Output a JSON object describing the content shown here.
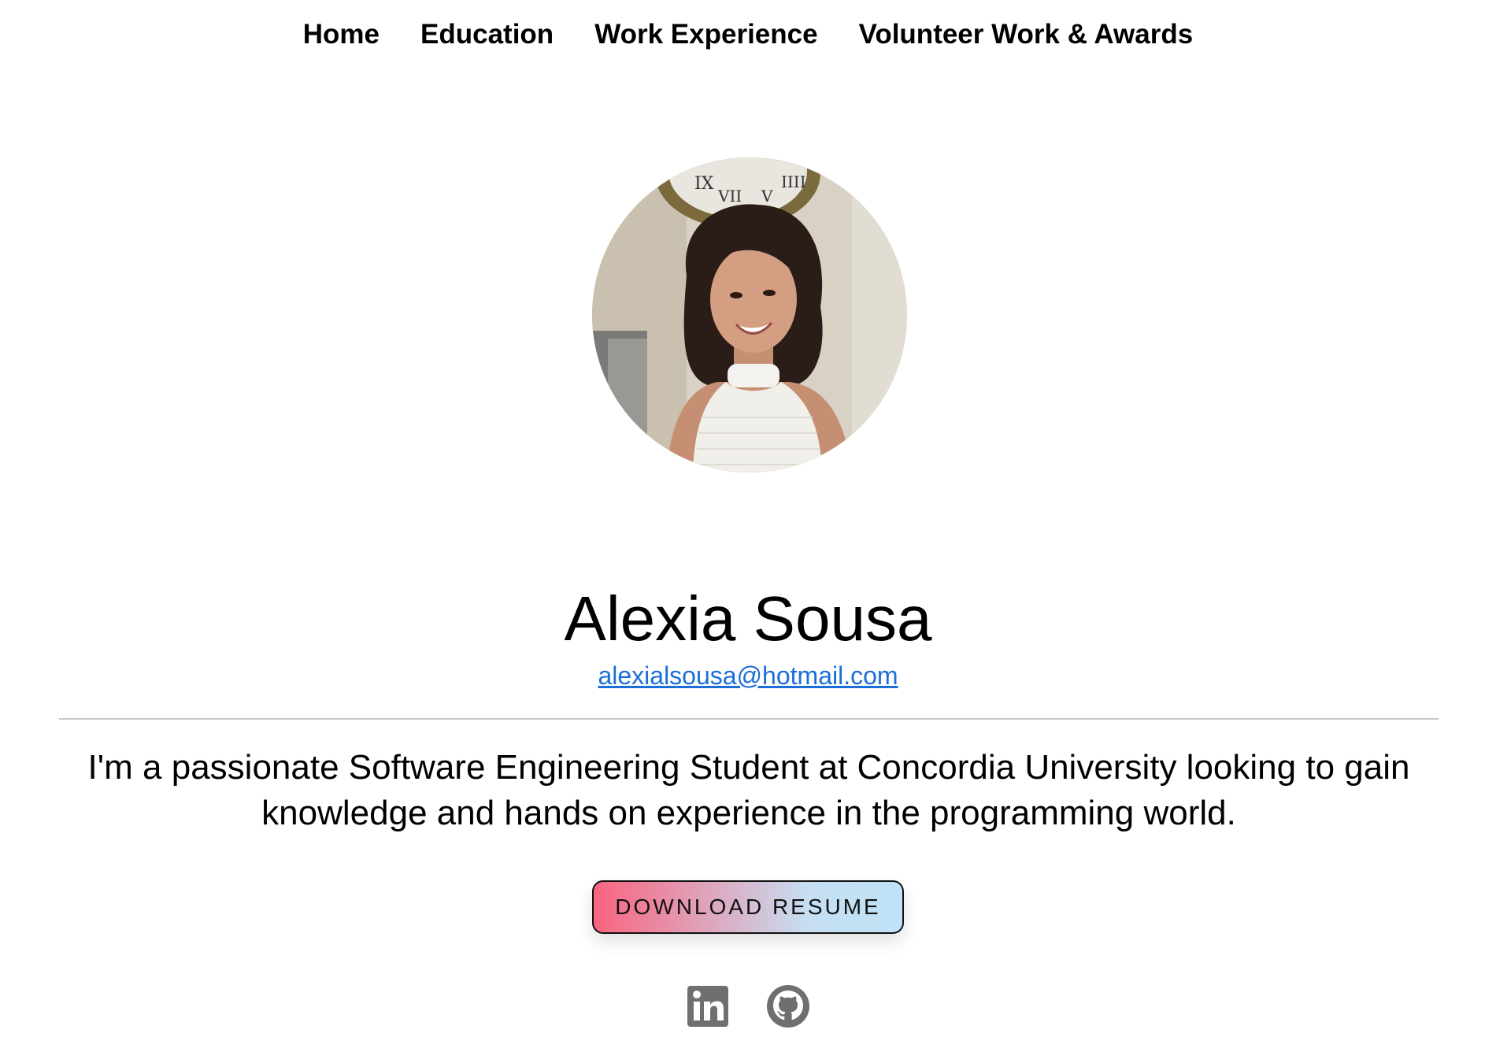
{
  "nav": {
    "items": [
      {
        "label": "Home"
      },
      {
        "label": "Education"
      },
      {
        "label": "Work Experience"
      },
      {
        "label": "Volunteer Work & Awards"
      }
    ]
  },
  "profile": {
    "name": "Alexia Sousa",
    "email": "alexialsousa@hotmail.com",
    "bio": "I'm a passionate Software Engineering Student at Concordia University looking to gain knowledge and hands on experience in the programming world."
  },
  "resume_button": {
    "label": "DOWNLOAD RESUME"
  },
  "socials": [
    {
      "icon": "linkedin-icon"
    },
    {
      "icon": "github-icon"
    }
  ],
  "colors": {
    "link": "#1a6ed8",
    "button_gradient_start": "#f9647f",
    "button_gradient_end": "#bfe2f6",
    "icon": "#6f6f6f"
  }
}
